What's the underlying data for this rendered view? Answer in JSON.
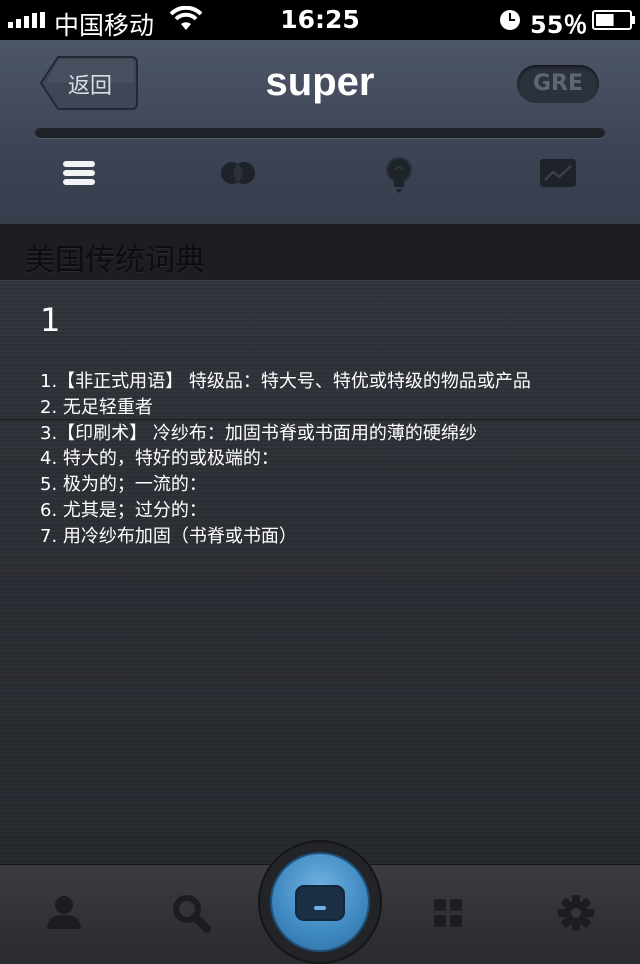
{
  "status_bar": {
    "carrier": "中国移动",
    "time": "16:25",
    "battery_percent": "55％",
    "battery_level": 0.55
  },
  "header": {
    "back_label": "返回",
    "title": "super",
    "badge": "GRE",
    "progress": 0.0
  },
  "tabs": [
    {
      "icon": "list-icon",
      "active": true
    },
    {
      "icon": "venn-icon",
      "active": false
    },
    {
      "icon": "lightbulb-icon",
      "active": false
    },
    {
      "icon": "chart-icon",
      "active": false
    }
  ],
  "section": {
    "title": "美国传统词典"
  },
  "entry": {
    "number": "1",
    "definitions": [
      "1.【非正式用语】 特级品：特大号、特优或特级的物品或产品",
      "2. 无足轻重者",
      "3.【印刷术】 冷纱布：加固书脊或书面用的薄的硬绵纱",
      "4. 特大的，特好的或极端的：",
      "5. 极为的；一流的：",
      "6. 尤其是；过分的：",
      "7. 用冷纱布加固（书脊或书面）"
    ]
  },
  "tabbar": {
    "items": [
      "profile-icon",
      "search-icon",
      "card-icon",
      "grid-icon",
      "gear-icon"
    ],
    "accent": "#4a90c7"
  }
}
